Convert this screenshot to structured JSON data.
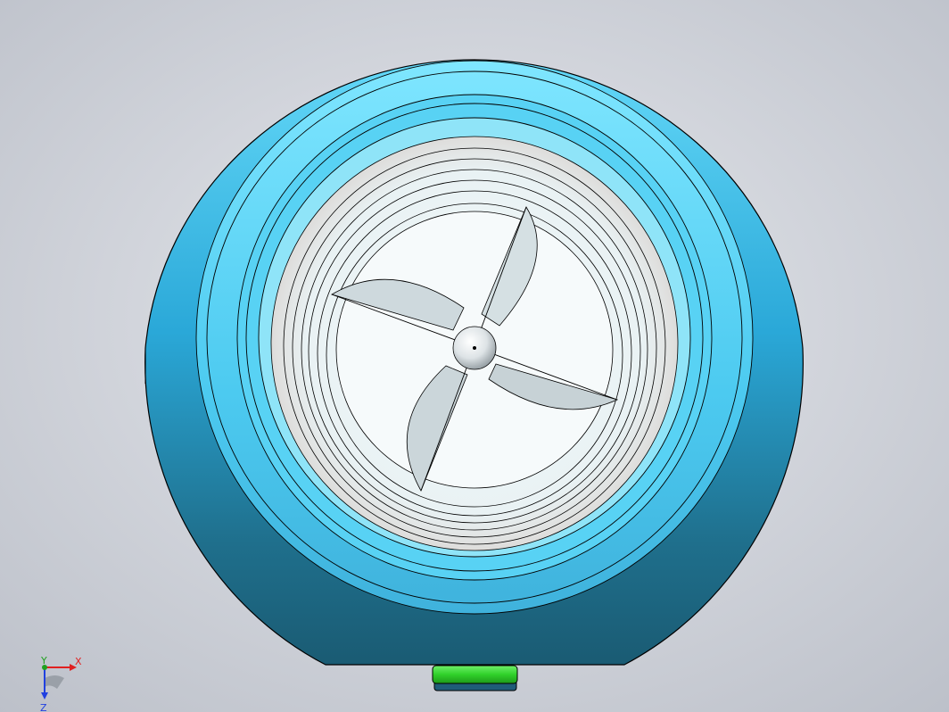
{
  "model_view": {
    "part": "blender-base-with-blade",
    "orientation": "top-view",
    "colors": {
      "background_center": "#e6e8ed",
      "background_edge": "#bcc0c9",
      "shell_light": "#63d8f8",
      "shell_mid": "#2aa8d8",
      "shell_dark": "#1a5b73",
      "ring_light": "#7fe6ff",
      "inner_bowl": "#eef5f7",
      "blade_fill": "#d3dde0",
      "button_green": "#30d12a",
      "edge_line": "#000000"
    }
  },
  "triad": {
    "x_label": "X",
    "y_label": "Y",
    "z_label": "Z",
    "x_color": "#e02020",
    "y_color": "#20a020",
    "z_color": "#2040e0"
  }
}
